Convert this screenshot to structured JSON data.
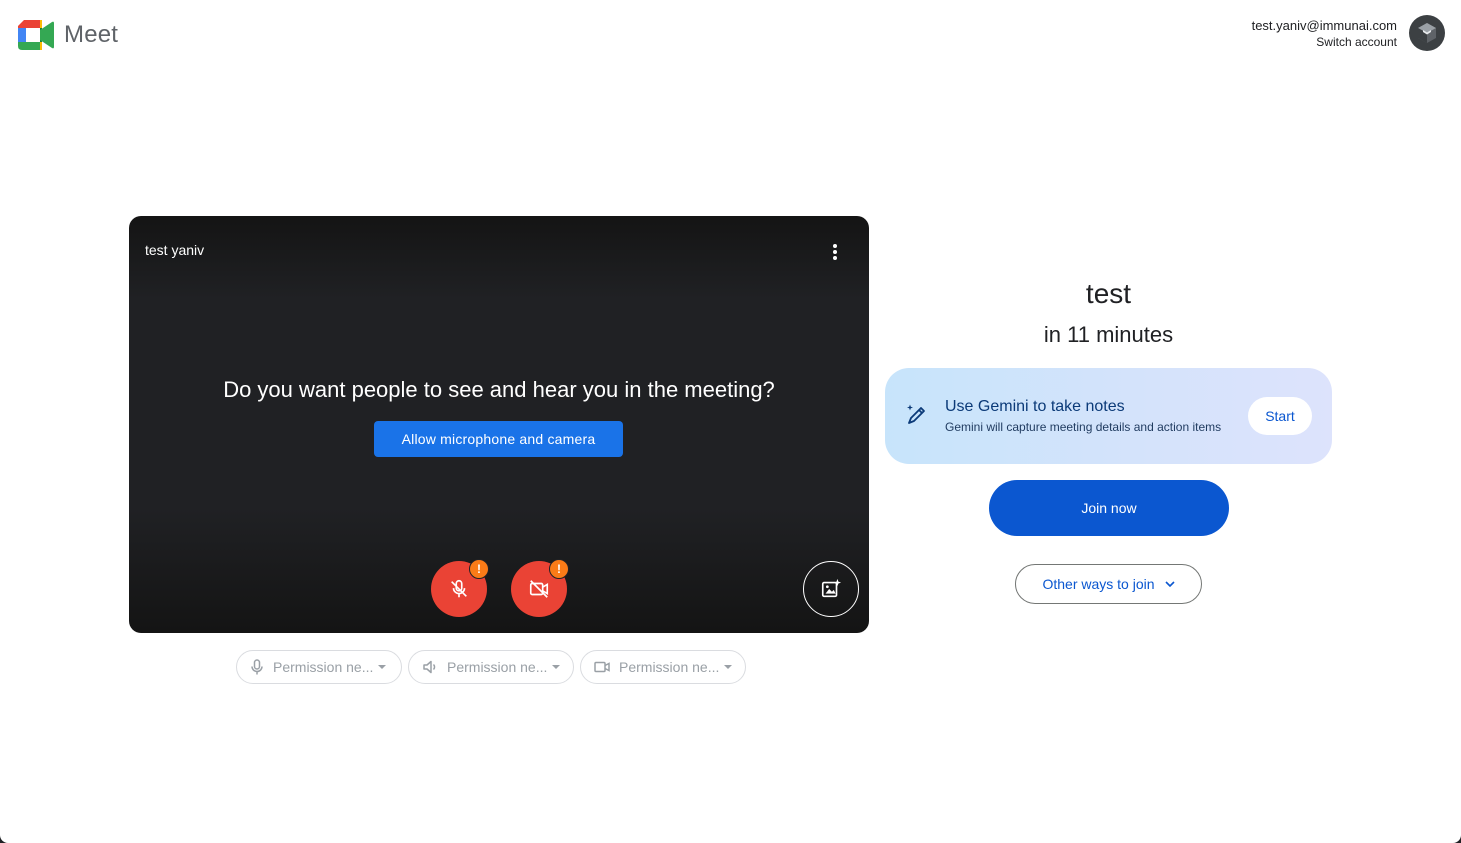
{
  "app": {
    "name": "Meet"
  },
  "account": {
    "email": "test.yaniv@immunai.com",
    "switch_label": "Switch account"
  },
  "preview": {
    "user_name": "test yaniv",
    "prompt": "Do you want people to see and hear you in the meeting?",
    "allow_label": "Allow microphone and camera",
    "mic_badge": "!",
    "cam_badge": "!",
    "status_colors": {
      "muted": "#ea4335",
      "warning": "#fa7b17"
    }
  },
  "devices": [
    {
      "icon": "microphone-icon",
      "label": "Permission ne..."
    },
    {
      "icon": "speaker-icon",
      "label": "Permission ne..."
    },
    {
      "icon": "camera-icon",
      "label": "Permission ne..."
    }
  ],
  "meeting": {
    "title": "test",
    "time": "in 11 minutes"
  },
  "gemini": {
    "title": "Use Gemini to take notes",
    "subtitle": "Gemini will capture meeting details and action items",
    "start_label": "Start"
  },
  "join": {
    "join_label": "Join now",
    "other_label": "Other ways to join"
  },
  "colors": {
    "primary": "#0b57d0",
    "allow_button": "#1a73e8"
  }
}
